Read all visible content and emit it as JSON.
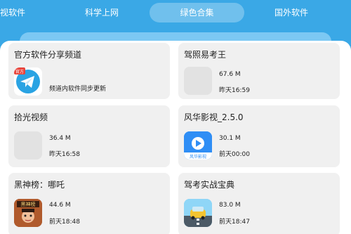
{
  "tabs": [
    {
      "label": "视软件"
    },
    {
      "label": "科学上网"
    },
    {
      "label": "绿色合集"
    },
    {
      "label": "国外软件"
    }
  ],
  "cards": [
    {
      "title": "官方软件分享频道",
      "description": "频道内软件同步更新",
      "icon": "telegram-icon",
      "badge": "官方"
    },
    {
      "title": "驾照易考王",
      "size": "67.6 M",
      "time": "昨天16:59",
      "icon": "placeholder-icon"
    },
    {
      "title": "拾光视频",
      "size": "36.4 M",
      "time": "昨天16:58",
      "icon": "placeholder-icon"
    },
    {
      "title": "风华影视_2.5.0",
      "size": "30.1 M",
      "time": "前天00:00",
      "icon": "tv-icon",
      "icon_text": "风华影视"
    },
    {
      "title": "黑神榜：哪吒",
      "size": "44.6 M",
      "time": "前天18:48",
      "icon": "game-icon",
      "icon_text": "黑神榜"
    },
    {
      "title": "驾考实战宝典",
      "size": "83.0 M",
      "time": "前天18:47",
      "icon": "car-icon"
    }
  ]
}
